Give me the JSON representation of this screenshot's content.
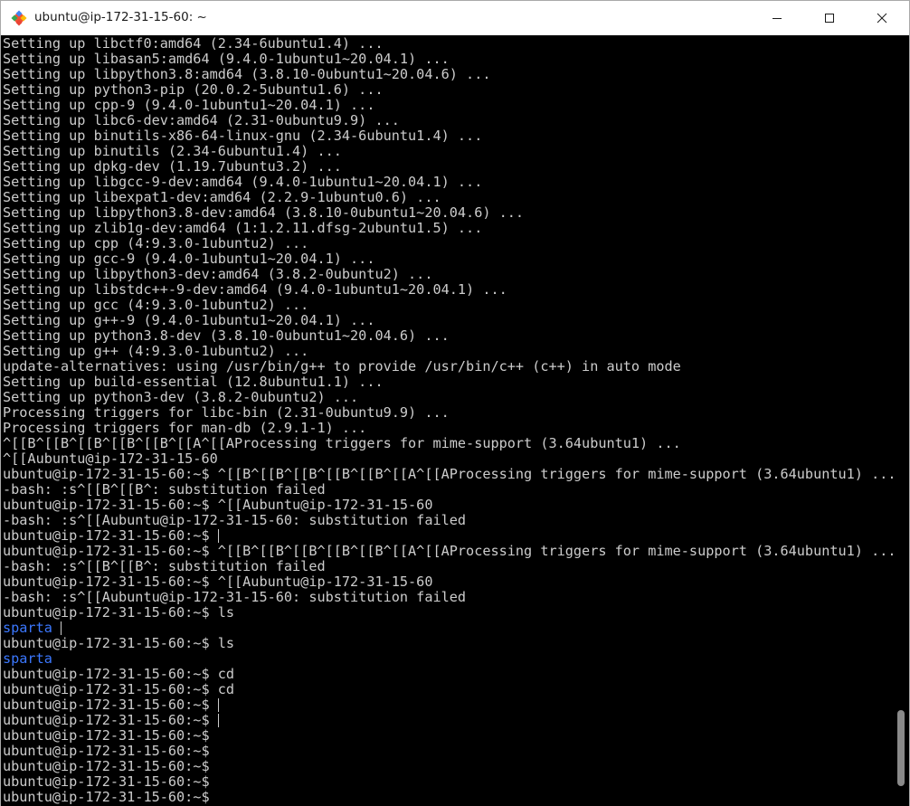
{
  "window": {
    "title": "ubuntu@ip-172-31-15-60: ~",
    "app_icon": "git-diamond-icon",
    "controls": [
      "minimize-icon",
      "maximize-icon",
      "close-icon"
    ]
  },
  "terminal": {
    "colors": {
      "background": "#000000",
      "foreground": "#cccccc",
      "directory": "#3b78ff"
    },
    "cursor_lines": [
      32,
      38,
      43,
      44
    ],
    "lines": [
      {
        "text": "Setting up libctf0:amd64 (2.34-6ubuntu1.4) ..."
      },
      {
        "text": "Setting up libasan5:amd64 (9.4.0-1ubuntu1~20.04.1) ..."
      },
      {
        "text": "Setting up libpython3.8:amd64 (3.8.10-0ubuntu1~20.04.6) ..."
      },
      {
        "text": "Setting up python3-pip (20.0.2-5ubuntu1.6) ..."
      },
      {
        "text": "Setting up cpp-9 (9.4.0-1ubuntu1~20.04.1) ..."
      },
      {
        "text": "Setting up libc6-dev:amd64 (2.31-0ubuntu9.9) ..."
      },
      {
        "text": "Setting up binutils-x86-64-linux-gnu (2.34-6ubuntu1.4) ..."
      },
      {
        "text": "Setting up binutils (2.34-6ubuntu1.4) ..."
      },
      {
        "text": "Setting up dpkg-dev (1.19.7ubuntu3.2) ..."
      },
      {
        "text": "Setting up libgcc-9-dev:amd64 (9.4.0-1ubuntu1~20.04.1) ..."
      },
      {
        "text": "Setting up libexpat1-dev:amd64 (2.2.9-1ubuntu0.6) ..."
      },
      {
        "text": "Setting up libpython3.8-dev:amd64 (3.8.10-0ubuntu1~20.04.6) ..."
      },
      {
        "text": "Setting up zlib1g-dev:amd64 (1:1.2.11.dfsg-2ubuntu1.5) ..."
      },
      {
        "text": "Setting up cpp (4:9.3.0-1ubuntu2) ..."
      },
      {
        "text": "Setting up gcc-9 (9.4.0-1ubuntu1~20.04.1) ..."
      },
      {
        "text": "Setting up libpython3-dev:amd64 (3.8.2-0ubuntu2) ..."
      },
      {
        "text": "Setting up libstdc++-9-dev:amd64 (9.4.0-1ubuntu1~20.04.1) ..."
      },
      {
        "text": "Setting up gcc (4:9.3.0-1ubuntu2) ..."
      },
      {
        "text": "Setting up g++-9 (9.4.0-1ubuntu1~20.04.1) ..."
      },
      {
        "text": "Setting up python3.8-dev (3.8.10-0ubuntu1~20.04.6) ..."
      },
      {
        "text": "Setting up g++ (4:9.3.0-1ubuntu2) ..."
      },
      {
        "text": "update-alternatives: using /usr/bin/g++ to provide /usr/bin/c++ (c++) in auto mode"
      },
      {
        "text": "Setting up build-essential (12.8ubuntu1.1) ..."
      },
      {
        "text": "Setting up python3-dev (3.8.2-0ubuntu2) ..."
      },
      {
        "text": "Processing triggers for libc-bin (2.31-0ubuntu9.9) ..."
      },
      {
        "text": "Processing triggers for man-db (2.9.1-1) ..."
      },
      {
        "text": "^[[B^[[B^[[B^[[B^[[B^[[A^[[AProcessing triggers for mime-support (3.64ubuntu1) ..."
      },
      {
        "text": "^[[Aubuntu@ip-172-31-15-60"
      },
      {
        "text": "ubuntu@ip-172-31-15-60:~$ ^[[B^[[B^[[B^[[B^[[B^[[A^[[AProcessing triggers for mime-support (3.64ubuntu1) ..."
      },
      {
        "text": "-bash: :s^[[B^[[B^: substitution failed"
      },
      {
        "text": "ubuntu@ip-172-31-15-60:~$ ^[[Aubuntu@ip-172-31-15-60"
      },
      {
        "text": "-bash: :s^[[Aubuntu@ip-172-31-15-60: substitution failed"
      },
      {
        "text": "ubuntu@ip-172-31-15-60:~$"
      },
      {
        "text": "ubuntu@ip-172-31-15-60:~$ ^[[B^[[B^[[B^[[B^[[B^[[A^[[AProcessing triggers for mime-support (3.64ubuntu1) ..."
      },
      {
        "text": "-bash: :s^[[B^[[B^: substitution failed"
      },
      {
        "text": "ubuntu@ip-172-31-15-60:~$ ^[[Aubuntu@ip-172-31-15-60"
      },
      {
        "text": "-bash: :s^[[Aubuntu@ip-172-31-15-60: substitution failed"
      },
      {
        "text": "ubuntu@ip-172-31-15-60:~$ ls"
      },
      {
        "text": "sparta",
        "kind": "dir"
      },
      {
        "text": "ubuntu@ip-172-31-15-60:~$ ls"
      },
      {
        "text": "sparta",
        "kind": "dir"
      },
      {
        "text": "ubuntu@ip-172-31-15-60:~$ cd"
      },
      {
        "text": "ubuntu@ip-172-31-15-60:~$ cd"
      },
      {
        "text": "ubuntu@ip-172-31-15-60:~$"
      },
      {
        "text": "ubuntu@ip-172-31-15-60:~$"
      },
      {
        "text": "ubuntu@ip-172-31-15-60:~$"
      },
      {
        "text": "ubuntu@ip-172-31-15-60:~$"
      },
      {
        "text": "ubuntu@ip-172-31-15-60:~$"
      },
      {
        "text": "ubuntu@ip-172-31-15-60:~$"
      },
      {
        "text": "ubuntu@ip-172-31-15-60:~$"
      },
      {
        "text": "ubuntu@ip-172-31-15-60:~$"
      }
    ]
  }
}
